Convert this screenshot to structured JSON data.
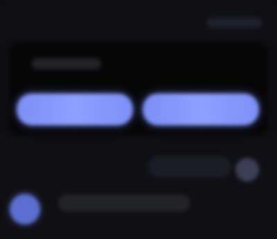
{
  "header": {
    "top_link_label": ""
  },
  "panel": {
    "label": "",
    "segments": [
      {
        "label": ""
      },
      {
        "label": ""
      }
    ]
  },
  "reply": {
    "pill_label": ""
  },
  "composer": {
    "placeholder": ""
  },
  "colors": {
    "background": "#101013",
    "panel": "#060607",
    "accent": "#8ea0ff",
    "avatar": "#5a6fcf"
  },
  "icons": {
    "round_button": "circle-button-icon",
    "avatar": "avatar-icon"
  }
}
